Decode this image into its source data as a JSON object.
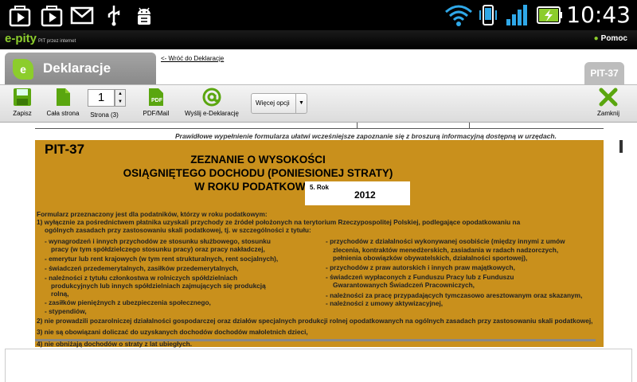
{
  "status_bar": {
    "time": "10:43",
    "icons": [
      "play-store-icon",
      "play-store-icon",
      "gmail-icon",
      "usb-icon",
      "android-debug-icon",
      "wifi-icon",
      "phone-vibrate-icon",
      "signal-icon",
      "battery-charging-icon"
    ]
  },
  "app": {
    "logo_name": "e-pity",
    "logo_sub": "PIT przez internet",
    "help_label": "Pomoc"
  },
  "header": {
    "tab_title": "Deklaracje",
    "back_link": "<- Wróć do Deklaracje",
    "form_tab": "PIT-37"
  },
  "toolbar": {
    "save": "Zapisz",
    "whole_page": "Cała strona",
    "page_value": "1",
    "page_label": "Strona (3)",
    "pdf": "PDF/Mail",
    "send": "Wyślij e-Deklarację",
    "more": "Więcej opcji",
    "close": "Zamknij"
  },
  "content": {
    "notice": "Prawidłowe wypełnienie formularza ułatwi wcześniejsze zapoznanie się z broszurą informacyjną dostępną w urzędach.",
    "form_code": "PIT-37",
    "title_lines": [
      "ZEZNANIE O WYSOKOŚCI",
      "OSIĄGNIĘTEGO DOCHODU (PONIESIONEJ STRATY)",
      "W ROKU PODATKOWYM"
    ],
    "year_label": "5. Rok",
    "year_value": "2012",
    "intro_lines": [
      "Formularz przeznaczony jest dla podatników, którzy w roku podatkowym:",
      "1) wyłącznie za pośrednictwem płatnika uzyskali przychody ze źródeł położonych na terytorium Rzeczypospolitej Polskiej, podlegające opodatkowaniu na",
      "   ogólnych zasadach przy zastosowaniu skali podatkowej, tj. w szczególności z tytułu:"
    ],
    "left_items": [
      "- wynagrodzeń i innych przychodów ze stosunku służbowego, stosunku",
      "  pracy (w tym spółdzielczego stosunku pracy) oraz pracy nakładczej,",
      "- emerytur lub rent krajowych (w tym rent strukturalnych, rent socjalnych),",
      "- świadczeń przedemerytalnych, zasiłków przedemerytalnych,",
      "- należności z tytułu członkostwa w rolniczych spółdzielniach",
      "  produkcyjnych lub innych spółdzielniach zajmujących się produkcją",
      "  rolną,",
      "- zasiłków pieniężnych z ubezpieczenia społecznego,",
      "- stypendiów,"
    ],
    "right_items": [
      "- przychodów z działalności wykonywanej osobiście (między innymi z umów",
      "  zlecenia, kontraktów menedżerskich, zasiadania w radach nadzorczych,",
      "  pełnienia obowiązków obywatelskich, działalności sportowej),",
      "- przychodów z praw autorskich i innych praw majątkowych,",
      "- świadczeń wypłaconych z Funduszu Pracy lub z Funduszu",
      "  Gwarantowanych Świadczeń Pracowniczych,",
      "- należności za pracę przypadających tymczasowo aresztowanym oraz skazanym,",
      "- należności z umowy aktywizacyjnej,"
    ],
    "numbered": [
      "2) nie prowadzili pozarolniczej działalności gospodarczej oraz działów specjalnych produkcji rolnej opodatkowanych na ogólnych zasadach przy zastosowaniu skali podatkowej,",
      "3) nie są obowiązani doliczać do uzyskanych dochodów dochodów małoletnich dzieci,",
      "4) nie obniżają dochodów o straty z lat ubiegłych."
    ]
  },
  "colors": {
    "form_bg": "#c9901c",
    "accent": "#8ccd2c",
    "statusbar": "#000000"
  }
}
